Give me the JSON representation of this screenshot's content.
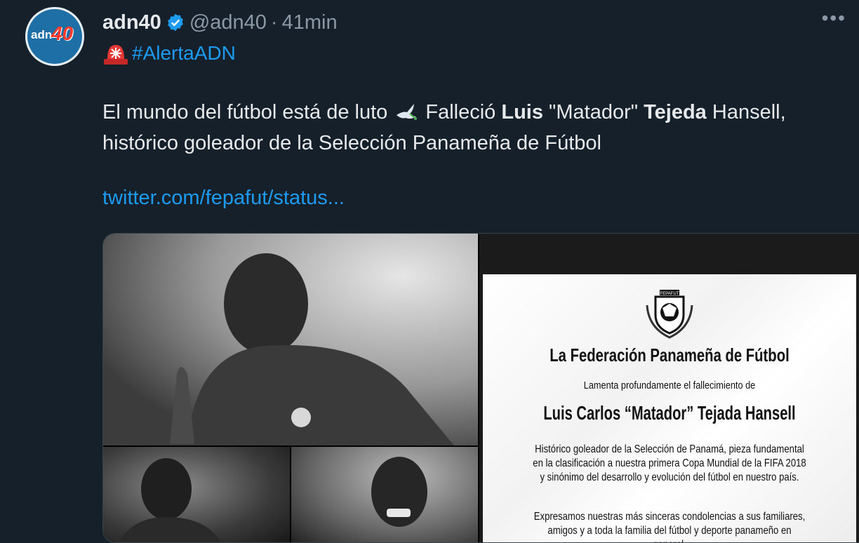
{
  "tweet": {
    "author": {
      "name": "adn40",
      "handle": "@adn40",
      "separator": "·",
      "time": "41min",
      "avatar_text": "adn",
      "avatar_number": "40"
    },
    "more_label": "•••",
    "hashtag": "#AlertaADN",
    "text": {
      "line1_part1": "El mundo del fútbol está de luto ",
      "line1_part2": " Falleció ",
      "bold1": "Luis",
      "mid": " \"Matador\" ",
      "bold2": "Tejeda",
      "end": " Hansell,",
      "line2": "histórico goleador de la Selección Panameña de Fútbol"
    },
    "link": "twitter.com/fepafut/status..."
  },
  "media": {
    "card": {
      "crest_text": "FEPAFUT",
      "federation": "La Federación Panameña de Fútbol",
      "lament": "Lamenta profundamente el fallecimiento de",
      "person": "Luis Carlos “Matador” Tejada Hansell",
      "bio": "Histórico goleador de la Selección de Panamá, pieza fundamental en la clasificación a nuestra primera Copa Mundial de la FIFA 2018 y sinónimo del desarrollo y evolución del fútbol en nuestro país.",
      "condolences": "Expresamos nuestras más sinceras condolencias a sus familiares, amigos y a toda la familia del fútbol y deporte panameño en general."
    }
  },
  "colors": {
    "background": "#15202b",
    "accent": "#1d9bf0",
    "muted": "#8b98a5",
    "text": "#e7e9ea",
    "verified": "#1d9bf0"
  }
}
